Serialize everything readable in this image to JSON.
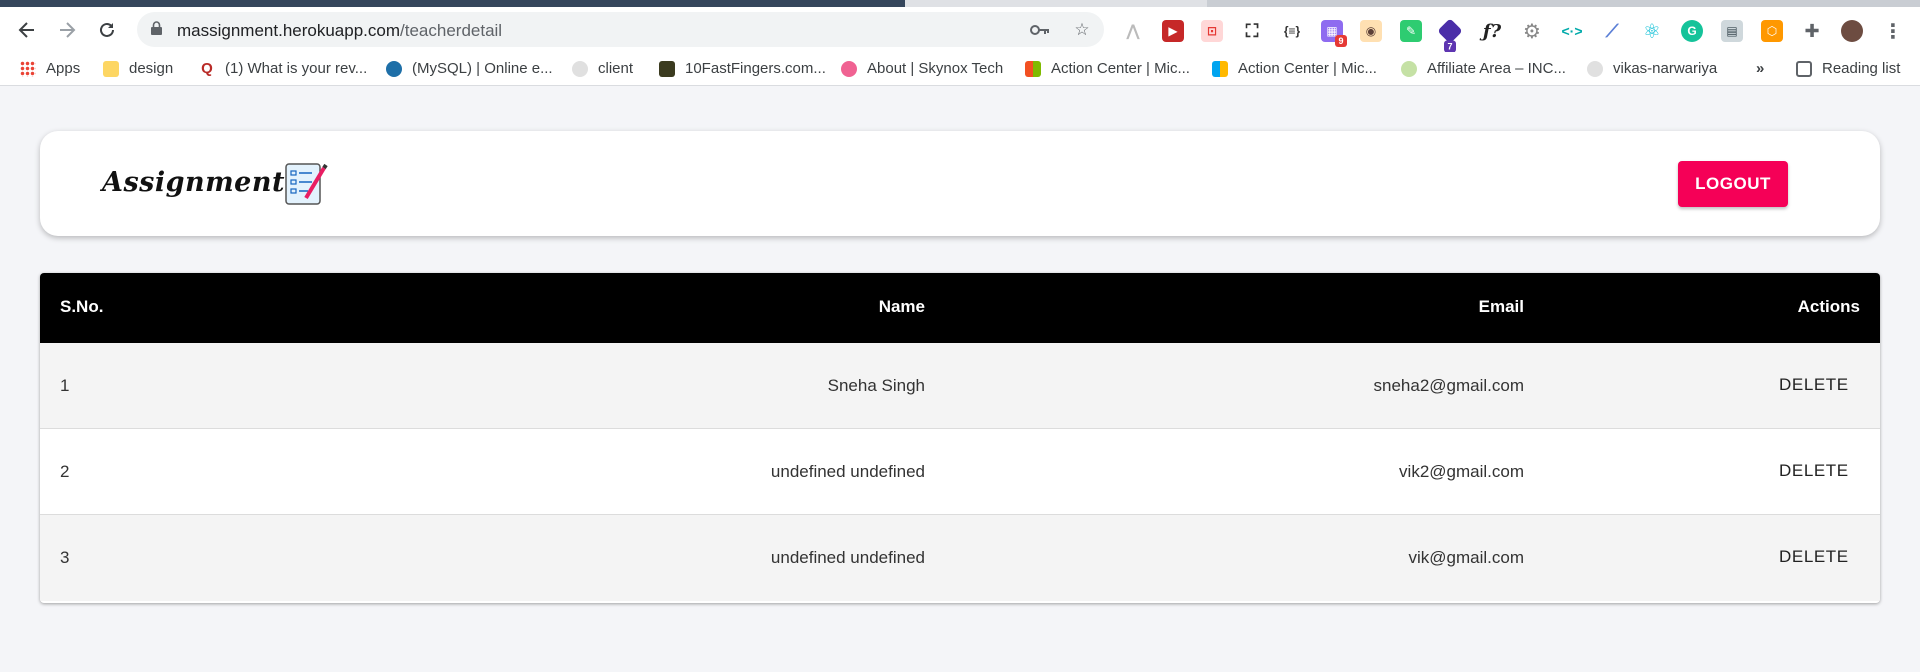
{
  "browser": {
    "url_host": "massignment.herokuapp.com",
    "url_path": "/teacherdetail",
    "extension_badges": {
      "ext_a": "9",
      "ext_b": "7"
    },
    "more_bookmarks": "»",
    "reading_list": "Reading list",
    "bookmarks": [
      {
        "label": "Apps",
        "icon": "apps-grid-icon"
      },
      {
        "label": "design",
        "icon": "folder-icon"
      },
      {
        "label": "(1) What is your rev...",
        "icon": "quora-icon"
      },
      {
        "label": "(MySQL) | Online e...",
        "icon": "site-icon"
      },
      {
        "label": "client",
        "icon": "github-icon"
      },
      {
        "label": "10FastFingers.com...",
        "icon": "site-icon"
      },
      {
        "label": "About | Skynox Tech",
        "icon": "site-icon"
      },
      {
        "label": "Action Center | Mic...",
        "icon": "microsoft-icon"
      },
      {
        "label": "Action Center | Mic...",
        "icon": "microsoft-icon"
      },
      {
        "label": "Affiliate Area – INC...",
        "icon": "site-icon"
      },
      {
        "label": "vikas-narwariya",
        "icon": "github-icon"
      }
    ]
  },
  "app": {
    "logo_text": "Assignment",
    "logout_label": "LOGOUT",
    "accent_color": "#f50057"
  },
  "table": {
    "headers": {
      "sno": "S.No.",
      "name": "Name",
      "email": "Email",
      "actions": "Actions"
    },
    "rows": [
      {
        "sno": "1",
        "name": "Sneha Singh",
        "email": "sneha2@gmail.com",
        "action": "DELETE"
      },
      {
        "sno": "2",
        "name": "undefined undefined",
        "email": "vik2@gmail.com",
        "action": "DELETE"
      },
      {
        "sno": "3",
        "name": "undefined undefined",
        "email": "vik@gmail.com",
        "action": "DELETE"
      }
    ]
  }
}
